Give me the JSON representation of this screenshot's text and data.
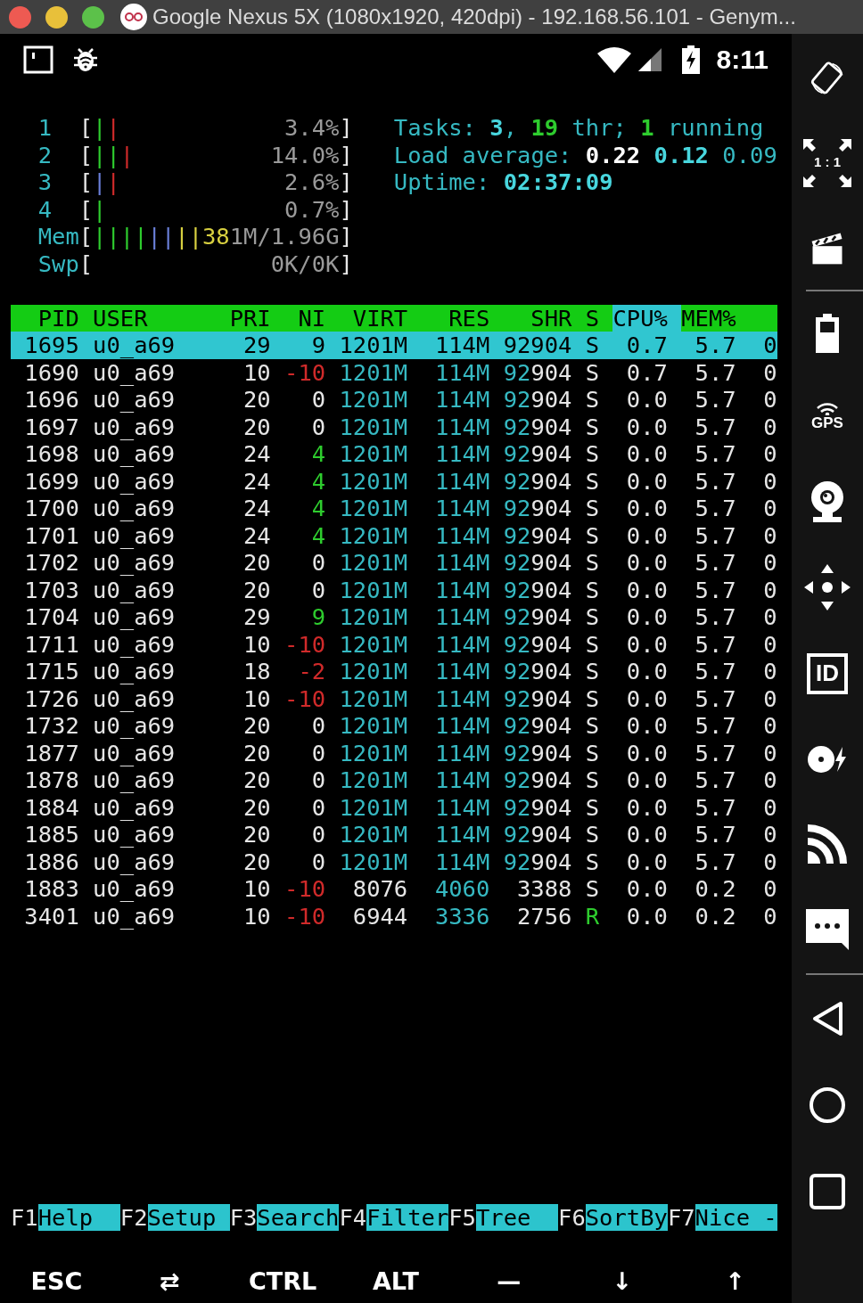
{
  "window": {
    "title": "Google Nexus 5X (1080x1920, 420dpi) - 192.168.56.101 - Genym..."
  },
  "status_bar": {
    "time": "8:11"
  },
  "meters": [
    {
      "label": "1",
      "bar_parts": [
        {
          "text": "["
        },
        {
          "text": "|",
          "color": "#2ecc2e"
        },
        {
          "text": "|",
          "color": "#d02a2a"
        }
      ],
      "value_parts": [
        {
          "text": "3.4%",
          "color": "#9a9a9a"
        },
        {
          "text": "]"
        }
      ]
    },
    {
      "label": "2",
      "bar_parts": [
        {
          "text": "["
        },
        {
          "text": "|",
          "color": "#2ecc2e"
        },
        {
          "text": "|",
          "color": "#2ecc2e"
        },
        {
          "text": "|",
          "color": "#d02a2a"
        }
      ],
      "value_parts": [
        {
          "text": "14.0%",
          "color": "#9a9a9a"
        },
        {
          "text": "]"
        }
      ]
    },
    {
      "label": "3",
      "bar_parts": [
        {
          "text": "["
        },
        {
          "text": "|",
          "color": "#6a7fd8"
        },
        {
          "text": "|",
          "color": "#d02a2a"
        }
      ],
      "value_parts": [
        {
          "text": "2.6%",
          "color": "#9a9a9a"
        },
        {
          "text": "]"
        }
      ]
    },
    {
      "label": "4",
      "bar_parts": [
        {
          "text": "["
        },
        {
          "text": "|",
          "color": "#2ecc2e"
        }
      ],
      "value_parts": [
        {
          "text": "0.7%",
          "color": "#9a9a9a"
        },
        {
          "text": "]"
        }
      ]
    },
    {
      "label": "Mem",
      "bar_parts": [
        {
          "text": "["
        },
        {
          "text": "|",
          "color": "#2ecc2e"
        },
        {
          "text": "|",
          "color": "#2ecc2e"
        },
        {
          "text": "|",
          "color": "#2ecc2e"
        },
        {
          "text": "|",
          "color": "#2ecc2e"
        },
        {
          "text": "|",
          "color": "#6a7fd8"
        },
        {
          "text": "|",
          "color": "#6a7fd8"
        },
        {
          "text": "|",
          "color": "#d8d040"
        },
        {
          "text": "|",
          "color": "#d8d040"
        }
      ],
      "value_parts": [
        {
          "text": "38",
          "color": "#d8d040"
        },
        {
          "text": "1M/1.96G",
          "color": "#9a9a9a"
        },
        {
          "text": "]"
        }
      ]
    },
    {
      "label": "Swp",
      "bar_parts": [
        {
          "text": "["
        }
      ],
      "value_parts": [
        {
          "text": "0K/0K",
          "color": "#9a9a9a"
        },
        {
          "text": "]"
        }
      ]
    }
  ],
  "summary": [
    [
      {
        "text": "Tasks: ",
        "color": "#36b9c2"
      },
      {
        "text": "3",
        "color": "#48d6de",
        "bold": true
      },
      {
        "text": ", ",
        "color": "#36b9c2"
      },
      {
        "text": "19",
        "color": "#2ecc2e",
        "bold": true
      },
      {
        "text": " thr; ",
        "color": "#36b9c2"
      },
      {
        "text": "1",
        "color": "#2ecc2e",
        "bold": true
      },
      {
        "text": " running",
        "color": "#36b9c2"
      }
    ],
    [
      {
        "text": "Load average: ",
        "color": "#36b9c2"
      },
      {
        "text": "0.22 ",
        "color": "#ffffff",
        "bold": true
      },
      {
        "text": "0.12 ",
        "color": "#48d6de",
        "bold": true
      },
      {
        "text": "0.09",
        "color": "#36b9c2"
      }
    ],
    [
      {
        "text": "Uptime: ",
        "color": "#36b9c2"
      },
      {
        "text": "02:37:09",
        "color": "#48d6de",
        "bold": true
      }
    ]
  ],
  "table": {
    "columns": [
      {
        "label": "PID",
        "sorted": false
      },
      {
        "label": "USER",
        "sorted": false
      },
      {
        "label": "PRI",
        "sorted": false
      },
      {
        "label": "NI",
        "sorted": false
      },
      {
        "label": "VIRT",
        "sorted": false
      },
      {
        "label": "RES",
        "sorted": false
      },
      {
        "label": "SHR",
        "sorted": false
      },
      {
        "label": "S",
        "sorted": false
      },
      {
        "label": "CPU%",
        "sorted": true
      },
      {
        "label": "MEM%",
        "sorted": false
      }
    ],
    "rows": [
      {
        "selected": true,
        "cells": [
          {
            "text": "1695"
          },
          {
            "text": "u0_a69"
          },
          {
            "text": "29"
          },
          {
            "text": "9"
          },
          {
            "text": "1201M"
          },
          {
            "text": "114M"
          },
          {
            "text": "92904"
          },
          {
            "text": "S"
          },
          {
            "text": "0.7"
          },
          {
            "text": "5.7"
          },
          {
            "text": "0"
          }
        ]
      },
      {
        "selected": false,
        "cells": [
          {
            "text": "1690"
          },
          {
            "text": "u0_a69"
          },
          {
            "text": "10"
          },
          {
            "text": "-10",
            "color": "#d02a2a"
          },
          {
            "text": "1201M",
            "color": "#36b9c2"
          },
          {
            "text": "114M",
            "color": "#36b9c2"
          },
          {
            "parts": [
              {
                "text": "92",
                "color": "#36b9c2"
              },
              {
                "text": "904"
              }
            ]
          },
          {
            "text": "S"
          },
          {
            "text": "0.7"
          },
          {
            "text": "5.7"
          },
          {
            "text": "0"
          }
        ]
      },
      {
        "selected": false,
        "cells": [
          {
            "text": "1696"
          },
          {
            "text": "u0_a69"
          },
          {
            "text": "20"
          },
          {
            "text": "0"
          },
          {
            "text": "1201M",
            "color": "#36b9c2"
          },
          {
            "text": "114M",
            "color": "#36b9c2"
          },
          {
            "parts": [
              {
                "text": "92",
                "color": "#36b9c2"
              },
              {
                "text": "904"
              }
            ]
          },
          {
            "text": "S"
          },
          {
            "text": "0.0"
          },
          {
            "text": "5.7"
          },
          {
            "text": "0"
          }
        ]
      },
      {
        "selected": false,
        "cells": [
          {
            "text": "1697"
          },
          {
            "text": "u0_a69"
          },
          {
            "text": "20"
          },
          {
            "text": "0"
          },
          {
            "text": "1201M",
            "color": "#36b9c2"
          },
          {
            "text": "114M",
            "color": "#36b9c2"
          },
          {
            "parts": [
              {
                "text": "92",
                "color": "#36b9c2"
              },
              {
                "text": "904"
              }
            ]
          },
          {
            "text": "S"
          },
          {
            "text": "0.0"
          },
          {
            "text": "5.7"
          },
          {
            "text": "0"
          }
        ]
      },
      {
        "selected": false,
        "cells": [
          {
            "text": "1698"
          },
          {
            "text": "u0_a69"
          },
          {
            "text": "24"
          },
          {
            "text": "4",
            "color": "#2ecc2e"
          },
          {
            "text": "1201M",
            "color": "#36b9c2"
          },
          {
            "text": "114M",
            "color": "#36b9c2"
          },
          {
            "parts": [
              {
                "text": "92",
                "color": "#36b9c2"
              },
              {
                "text": "904"
              }
            ]
          },
          {
            "text": "S"
          },
          {
            "text": "0.0"
          },
          {
            "text": "5.7"
          },
          {
            "text": "0"
          }
        ]
      },
      {
        "selected": false,
        "cells": [
          {
            "text": "1699"
          },
          {
            "text": "u0_a69"
          },
          {
            "text": "24"
          },
          {
            "text": "4",
            "color": "#2ecc2e"
          },
          {
            "text": "1201M",
            "color": "#36b9c2"
          },
          {
            "text": "114M",
            "color": "#36b9c2"
          },
          {
            "parts": [
              {
                "text": "92",
                "color": "#36b9c2"
              },
              {
                "text": "904"
              }
            ]
          },
          {
            "text": "S"
          },
          {
            "text": "0.0"
          },
          {
            "text": "5.7"
          },
          {
            "text": "0"
          }
        ]
      },
      {
        "selected": false,
        "cells": [
          {
            "text": "1700"
          },
          {
            "text": "u0_a69"
          },
          {
            "text": "24"
          },
          {
            "text": "4",
            "color": "#2ecc2e"
          },
          {
            "text": "1201M",
            "color": "#36b9c2"
          },
          {
            "text": "114M",
            "color": "#36b9c2"
          },
          {
            "parts": [
              {
                "text": "92",
                "color": "#36b9c2"
              },
              {
                "text": "904"
              }
            ]
          },
          {
            "text": "S"
          },
          {
            "text": "0.0"
          },
          {
            "text": "5.7"
          },
          {
            "text": "0"
          }
        ]
      },
      {
        "selected": false,
        "cells": [
          {
            "text": "1701"
          },
          {
            "text": "u0_a69"
          },
          {
            "text": "24"
          },
          {
            "text": "4",
            "color": "#2ecc2e"
          },
          {
            "text": "1201M",
            "color": "#36b9c2"
          },
          {
            "text": "114M",
            "color": "#36b9c2"
          },
          {
            "parts": [
              {
                "text": "92",
                "color": "#36b9c2"
              },
              {
                "text": "904"
              }
            ]
          },
          {
            "text": "S"
          },
          {
            "text": "0.0"
          },
          {
            "text": "5.7"
          },
          {
            "text": "0"
          }
        ]
      },
      {
        "selected": false,
        "cells": [
          {
            "text": "1702"
          },
          {
            "text": "u0_a69"
          },
          {
            "text": "20"
          },
          {
            "text": "0"
          },
          {
            "text": "1201M",
            "color": "#36b9c2"
          },
          {
            "text": "114M",
            "color": "#36b9c2"
          },
          {
            "parts": [
              {
                "text": "92",
                "color": "#36b9c2"
              },
              {
                "text": "904"
              }
            ]
          },
          {
            "text": "S"
          },
          {
            "text": "0.0"
          },
          {
            "text": "5.7"
          },
          {
            "text": "0"
          }
        ]
      },
      {
        "selected": false,
        "cells": [
          {
            "text": "1703"
          },
          {
            "text": "u0_a69"
          },
          {
            "text": "20"
          },
          {
            "text": "0"
          },
          {
            "text": "1201M",
            "color": "#36b9c2"
          },
          {
            "text": "114M",
            "color": "#36b9c2"
          },
          {
            "parts": [
              {
                "text": "92",
                "color": "#36b9c2"
              },
              {
                "text": "904"
              }
            ]
          },
          {
            "text": "S"
          },
          {
            "text": "0.0"
          },
          {
            "text": "5.7"
          },
          {
            "text": "0"
          }
        ]
      },
      {
        "selected": false,
        "cells": [
          {
            "text": "1704"
          },
          {
            "text": "u0_a69"
          },
          {
            "text": "29"
          },
          {
            "text": "9",
            "color": "#2ecc2e"
          },
          {
            "text": "1201M",
            "color": "#36b9c2"
          },
          {
            "text": "114M",
            "color": "#36b9c2"
          },
          {
            "parts": [
              {
                "text": "92",
                "color": "#36b9c2"
              },
              {
                "text": "904"
              }
            ]
          },
          {
            "text": "S"
          },
          {
            "text": "0.0"
          },
          {
            "text": "5.7"
          },
          {
            "text": "0"
          }
        ]
      },
      {
        "selected": false,
        "cells": [
          {
            "text": "1711"
          },
          {
            "text": "u0_a69"
          },
          {
            "text": "10"
          },
          {
            "text": "-10",
            "color": "#d02a2a"
          },
          {
            "text": "1201M",
            "color": "#36b9c2"
          },
          {
            "text": "114M",
            "color": "#36b9c2"
          },
          {
            "parts": [
              {
                "text": "92",
                "color": "#36b9c2"
              },
              {
                "text": "904"
              }
            ]
          },
          {
            "text": "S"
          },
          {
            "text": "0.0"
          },
          {
            "text": "5.7"
          },
          {
            "text": "0"
          }
        ]
      },
      {
        "selected": false,
        "cells": [
          {
            "text": "1715"
          },
          {
            "text": "u0_a69"
          },
          {
            "text": "18"
          },
          {
            "text": "-2",
            "color": "#d02a2a"
          },
          {
            "text": "1201M",
            "color": "#36b9c2"
          },
          {
            "text": "114M",
            "color": "#36b9c2"
          },
          {
            "parts": [
              {
                "text": "92",
                "color": "#36b9c2"
              },
              {
                "text": "904"
              }
            ]
          },
          {
            "text": "S"
          },
          {
            "text": "0.0"
          },
          {
            "text": "5.7"
          },
          {
            "text": "0"
          }
        ]
      },
      {
        "selected": false,
        "cells": [
          {
            "text": "1726"
          },
          {
            "text": "u0_a69"
          },
          {
            "text": "10"
          },
          {
            "text": "-10",
            "color": "#d02a2a"
          },
          {
            "text": "1201M",
            "color": "#36b9c2"
          },
          {
            "text": "114M",
            "color": "#36b9c2"
          },
          {
            "parts": [
              {
                "text": "92",
                "color": "#36b9c2"
              },
              {
                "text": "904"
              }
            ]
          },
          {
            "text": "S"
          },
          {
            "text": "0.0"
          },
          {
            "text": "5.7"
          },
          {
            "text": "0"
          }
        ]
      },
      {
        "selected": false,
        "cells": [
          {
            "text": "1732"
          },
          {
            "text": "u0_a69"
          },
          {
            "text": "20"
          },
          {
            "text": "0"
          },
          {
            "text": "1201M",
            "color": "#36b9c2"
          },
          {
            "text": "114M",
            "color": "#36b9c2"
          },
          {
            "parts": [
              {
                "text": "92",
                "color": "#36b9c2"
              },
              {
                "text": "904"
              }
            ]
          },
          {
            "text": "S"
          },
          {
            "text": "0.0"
          },
          {
            "text": "5.7"
          },
          {
            "text": "0"
          }
        ]
      },
      {
        "selected": false,
        "cells": [
          {
            "text": "1877"
          },
          {
            "text": "u0_a69"
          },
          {
            "text": "20"
          },
          {
            "text": "0"
          },
          {
            "text": "1201M",
            "color": "#36b9c2"
          },
          {
            "text": "114M",
            "color": "#36b9c2"
          },
          {
            "parts": [
              {
                "text": "92",
                "color": "#36b9c2"
              },
              {
                "text": "904"
              }
            ]
          },
          {
            "text": "S"
          },
          {
            "text": "0.0"
          },
          {
            "text": "5.7"
          },
          {
            "text": "0"
          }
        ]
      },
      {
        "selected": false,
        "cells": [
          {
            "text": "1878"
          },
          {
            "text": "u0_a69"
          },
          {
            "text": "20"
          },
          {
            "text": "0"
          },
          {
            "text": "1201M",
            "color": "#36b9c2"
          },
          {
            "text": "114M",
            "color": "#36b9c2"
          },
          {
            "parts": [
              {
                "text": "92",
                "color": "#36b9c2"
              },
              {
                "text": "904"
              }
            ]
          },
          {
            "text": "S"
          },
          {
            "text": "0.0"
          },
          {
            "text": "5.7"
          },
          {
            "text": "0"
          }
        ]
      },
      {
        "selected": false,
        "cells": [
          {
            "text": "1884"
          },
          {
            "text": "u0_a69"
          },
          {
            "text": "20"
          },
          {
            "text": "0"
          },
          {
            "text": "1201M",
            "color": "#36b9c2"
          },
          {
            "text": "114M",
            "color": "#36b9c2"
          },
          {
            "parts": [
              {
                "text": "92",
                "color": "#36b9c2"
              },
              {
                "text": "904"
              }
            ]
          },
          {
            "text": "S"
          },
          {
            "text": "0.0"
          },
          {
            "text": "5.7"
          },
          {
            "text": "0"
          }
        ]
      },
      {
        "selected": false,
        "cells": [
          {
            "text": "1885"
          },
          {
            "text": "u0_a69"
          },
          {
            "text": "20"
          },
          {
            "text": "0"
          },
          {
            "text": "1201M",
            "color": "#36b9c2"
          },
          {
            "text": "114M",
            "color": "#36b9c2"
          },
          {
            "parts": [
              {
                "text": "92",
                "color": "#36b9c2"
              },
              {
                "text": "904"
              }
            ]
          },
          {
            "text": "S"
          },
          {
            "text": "0.0"
          },
          {
            "text": "5.7"
          },
          {
            "text": "0"
          }
        ]
      },
      {
        "selected": false,
        "cells": [
          {
            "text": "1886"
          },
          {
            "text": "u0_a69"
          },
          {
            "text": "20"
          },
          {
            "text": "0"
          },
          {
            "text": "1201M",
            "color": "#36b9c2"
          },
          {
            "text": "114M",
            "color": "#36b9c2"
          },
          {
            "parts": [
              {
                "text": "92",
                "color": "#36b9c2"
              },
              {
                "text": "904"
              }
            ]
          },
          {
            "text": "S"
          },
          {
            "text": "0.0"
          },
          {
            "text": "5.7"
          },
          {
            "text": "0"
          }
        ]
      },
      {
        "selected": false,
        "cells": [
          {
            "text": "1883"
          },
          {
            "text": "u0_a69"
          },
          {
            "text": "10"
          },
          {
            "text": "-10",
            "color": "#d02a2a"
          },
          {
            "text": "8076"
          },
          {
            "text": "4060",
            "color": "#36b9c2"
          },
          {
            "text": "3388"
          },
          {
            "text": "S"
          },
          {
            "text": "0.0"
          },
          {
            "text": "0.2"
          },
          {
            "text": "0"
          }
        ]
      },
      {
        "selected": false,
        "cells": [
          {
            "text": "3401"
          },
          {
            "text": "u0_a69"
          },
          {
            "text": "10"
          },
          {
            "text": "-10",
            "color": "#d02a2a"
          },
          {
            "text": "6944"
          },
          {
            "text": "3336",
            "color": "#36b9c2"
          },
          {
            "text": "2756"
          },
          {
            "text": "R",
            "color": "#2ecc2e"
          },
          {
            "text": "0.0"
          },
          {
            "text": "0.2"
          },
          {
            "text": "0"
          }
        ]
      }
    ]
  },
  "function_keys": [
    {
      "key": "F1",
      "label": "Help"
    },
    {
      "key": "F2",
      "label": "Setup"
    },
    {
      "key": "F3",
      "label": "Search"
    },
    {
      "key": "F4",
      "label": "Filter"
    },
    {
      "key": "F5",
      "label": "Tree"
    },
    {
      "key": "F6",
      "label": "SortBy"
    },
    {
      "key": "F7",
      "label": "Nice -"
    }
  ],
  "extra_keys": [
    "ESC",
    "⇄",
    "CTRL",
    "ALT",
    "—",
    "↓",
    "↑"
  ],
  "sidebar": {
    "scale_label": "1 : 1",
    "gps_label": "GPS",
    "id_label": "ID"
  }
}
